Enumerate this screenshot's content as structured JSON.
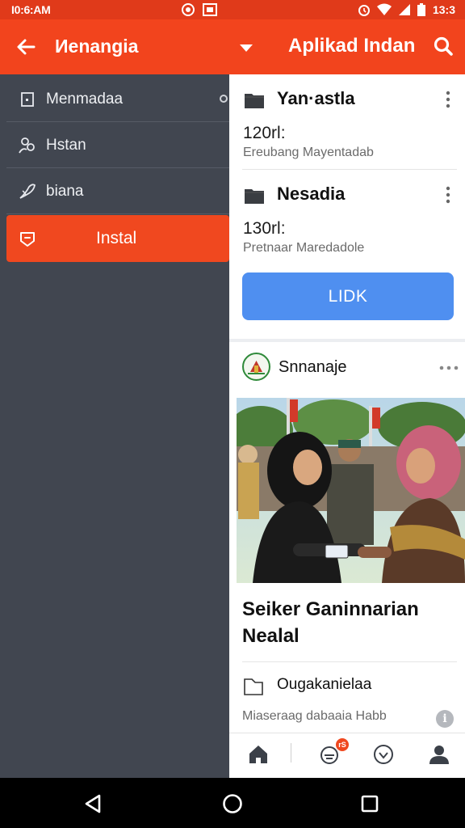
{
  "status_bar": {
    "time": "I0:6:AM",
    "clock_right": "13:3"
  },
  "app_bar": {
    "drawer_title": "Иenangia",
    "app_title": "Aplikad Indan"
  },
  "drawer": {
    "items": [
      {
        "label": "Menmadaa",
        "icon": "document-icon"
      },
      {
        "label": "Hstan",
        "icon": "people-icon"
      },
      {
        "label": "biana",
        "icon": "leaf-icon"
      },
      {
        "label": "Instal",
        "icon": "chat-icon"
      }
    ]
  },
  "documents": [
    {
      "name": "Yan·astla",
      "size": "120rl:",
      "subtitle": "Ereubang Mayentadab"
    },
    {
      "name": "Nesadia",
      "size": "130rl:",
      "subtitle": "Pretnaar Maredadole"
    }
  ],
  "primary_button": "LIDK",
  "post": {
    "author": "Snnanaje",
    "headline": "Seiker Ganinnarian Nealal",
    "file_label": "Ougakanielaa",
    "caption": "Miaseraag dabaaia Habb"
  },
  "bottom_nav": {
    "badge": "rS"
  },
  "colors": {
    "accent": "#f2441d",
    "drawer_bg": "#414650",
    "button_blue": "#4f8ff0"
  }
}
